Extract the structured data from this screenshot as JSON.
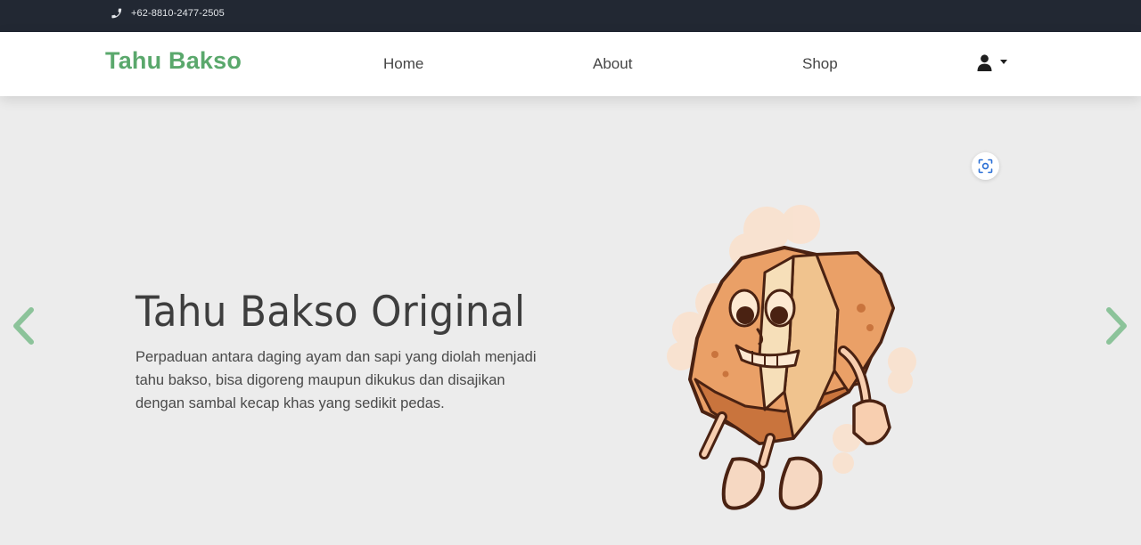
{
  "topbar": {
    "phone": "+62-8810-2477-2505",
    "phone_icon": "phone-icon"
  },
  "header": {
    "brand": "Tahu Bakso",
    "nav": {
      "home": "Home",
      "about": "About",
      "shop": "Shop"
    },
    "user_icon": "user-icon",
    "caret_icon": "caret-down-icon"
  },
  "hero": {
    "title": "Tahu Bakso Original",
    "description": "Perpaduan antara daging ayam dan sapi yang diolah menjadi tahu bakso, bisa digoreng maupun dikukus dan disajikan dengan sambal kecap khas yang sedikit pedas.",
    "prev_icon": "chevron-left-icon",
    "next_icon": "chevron-right-icon",
    "lens_icon": "visual-search-icon",
    "image": "tahu-bakso-mascot"
  },
  "colors": {
    "brand": "#5aa86c",
    "topbar_bg": "#222833",
    "hero_bg": "#ececec",
    "arrow": "#8cc39a"
  }
}
